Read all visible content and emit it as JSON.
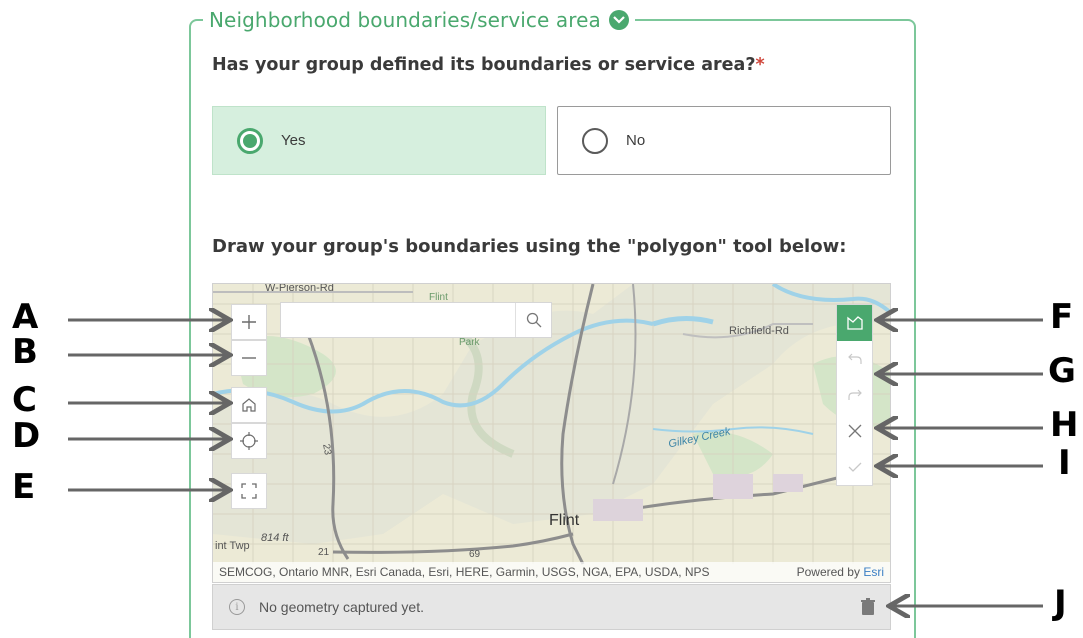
{
  "section": {
    "title": "Neighborhood boundaries/service area",
    "toggle_icon": "chevron-down-icon",
    "accent_color": "#4aa86e"
  },
  "question": {
    "text": "Has your group defined its boundaries or service area?",
    "required_mark": "*",
    "options": [
      {
        "label": "Yes",
        "selected": true
      },
      {
        "label": "No",
        "selected": false
      }
    ]
  },
  "map_prompt": "Draw your group's boundaries using the \"polygon\" tool below:",
  "map": {
    "search": {
      "placeholder": "",
      "value": ""
    },
    "labels": {
      "pierson": "W-Pierson-Rd",
      "flint_park_1": "Flint",
      "flint_park_2": "Park",
      "richfield": "Richfield-Rd",
      "gilkey": "Gilkey Creek",
      "flint": "Flint",
      "twp": "int Twp",
      "elev": "814 ft",
      "route21": "21",
      "route23": "23",
      "route69": "69"
    },
    "attribution": "SEMCOG, Ontario MNR, Esri Canada, Esri, HERE, Garmin, USGS, NGA, EPA, USDA, NPS",
    "powered_by": "Powered by",
    "powered_by_brand": "Esri"
  },
  "status": {
    "message": "No geometry captured yet."
  },
  "callouts": [
    "A",
    "B",
    "C",
    "D",
    "E",
    "F",
    "G",
    "H",
    "I",
    "J"
  ]
}
